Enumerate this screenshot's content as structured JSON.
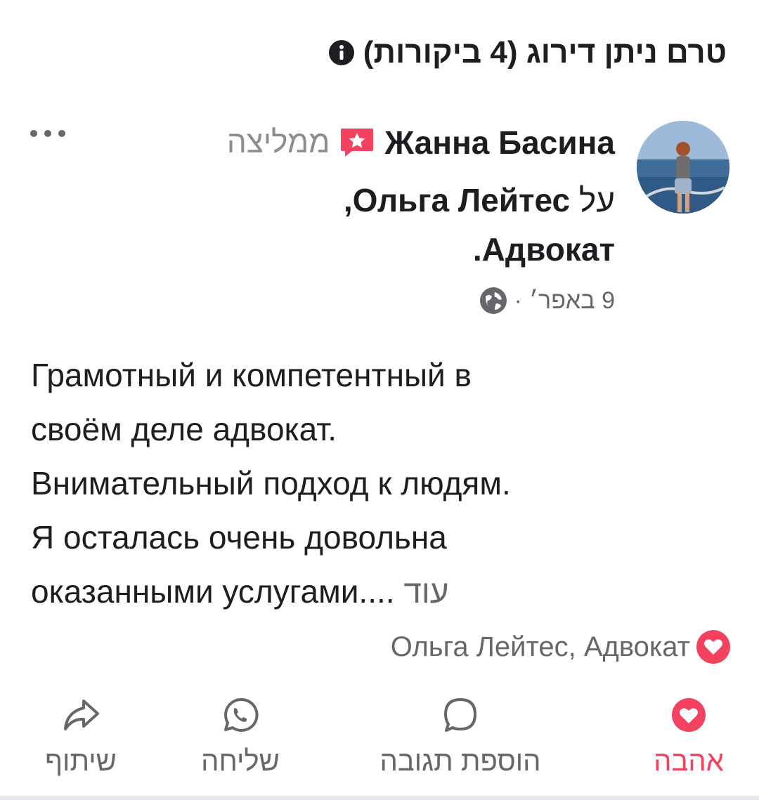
{
  "header": {
    "title": "טרם ניתן דירוג (4 ביקורות)",
    "info_icon": "info-circle-icon"
  },
  "review": {
    "reviewer_name": "Жанна Басина",
    "badge_icon": "recommend-badge-icon",
    "recommends_label": "ממליצה",
    "more_icon": "more-dots-icon",
    "about_prefix": "על",
    "target_name_part1": "Ольга Лейтес,",
    "target_name_part2": "Адвокат.",
    "date": "9 באפר׳",
    "separator": "·",
    "privacy_icon": "globe-icon",
    "body_lines": [
      "Грамотный и компетентный в",
      "своём деле адвокат.",
      "Внимательный подход к людям.",
      "Я осталась очень довольна",
      "оказанными услугами...."
    ],
    "see_more": "עוד"
  },
  "reactions": {
    "icon": "love-reaction-icon",
    "text": "Ольга Лейтес, Адвокат"
  },
  "actions": [
    {
      "label": "אהבה",
      "icon": "love-icon",
      "active": true
    },
    {
      "label": "הוספת תגובה",
      "icon": "comment-icon",
      "active": false
    },
    {
      "label": "שליחה",
      "icon": "whatsapp-icon",
      "active": false
    },
    {
      "label": "שיתוף",
      "icon": "share-icon",
      "active": false
    }
  ],
  "colors": {
    "love_accent": "#f3425f",
    "secondary_text": "#65676b",
    "badge_red": "#f3425f"
  }
}
